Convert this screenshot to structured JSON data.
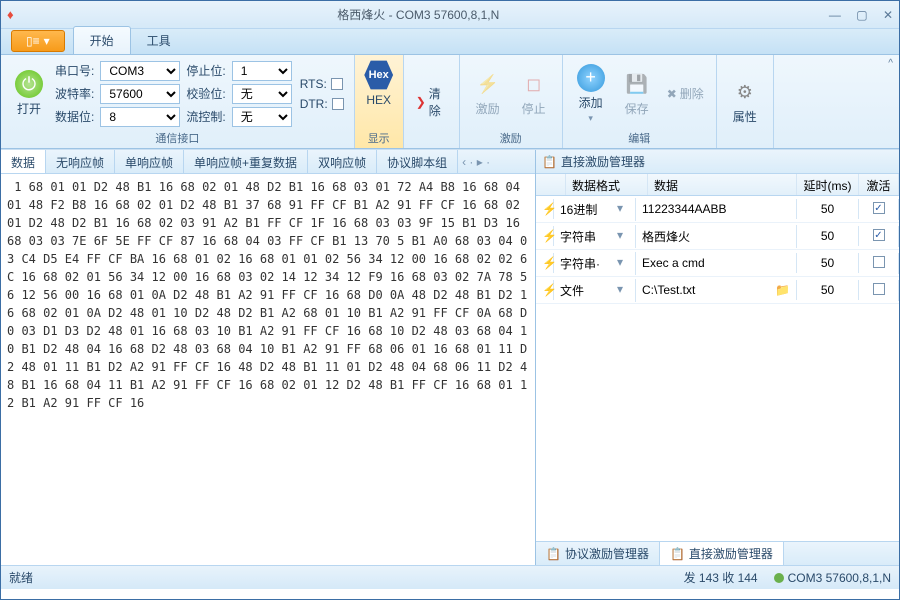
{
  "title": "格西烽火 - COM3  57600,8,1,N",
  "tabs": {
    "file": "▯≡",
    "t0": "开始",
    "t1": "工具"
  },
  "ribbon": {
    "open": "打开",
    "port_l": "串口号:",
    "port": "COM3",
    "baud_l": "波特率:",
    "baud": "57600",
    "dbit_l": "数据位:",
    "dbit": "8",
    "stop_l": "停止位:",
    "stop": "1",
    "par_l": "校验位:",
    "par": "无",
    "flow_l": "流控制:",
    "flow": "无",
    "rts": "RTS:",
    "dtr": "DTR:",
    "g_comm": "通信接口",
    "hex": "HEX",
    "g_show": "显示",
    "clear": "清除",
    "excite": "激励",
    "stop_btn": "停止",
    "g_excite": "激励",
    "add": "添加",
    "save": "保存",
    "del": "删除",
    "g_edit": "编辑",
    "props": "属性"
  },
  "datatabs": [
    "数据",
    "无响应帧",
    "单响应帧",
    "单响应帧+重复数据",
    "双响应帧",
    "协议脚本组"
  ],
  "hexdump": " 1 68 01 01 D2 48 B1 16 68 02 01 48 D2 B1 16 68 03 01 72 A4 B8 16 68 04 01 48 F2 B8 16 68 02 01 D2 48 B1 37 68 91 FF CF B1 A2 91 FF CF 16 68 02 01 D2 48 D2 B1 16 68 02 03 91 A2 B1 FF CF 1F 16 68 03 03 9F 15 B1 D3 16 68 03 03 7E 6F 5E FF CF 87 16 68 04 03 FF CF B1 13 70 5 B1 A0 68 03 04 03 C4 D5 E4 FF CF BA 16 68 01 02 16 68 01 01 02 56 34 12 00 16 68 02 02 6C 16 68 02 01 56 34 12 00 16 68 03 02 14 12 34 12 F9 16 68 03 02 7A 78 56 12 56 00 16 68 01 0A D2 48 B1 A2 91 FF CF 16 68 D0 0A 48 D2 48 B1 D2 16 68 02 01 0A D2 48 01 10 D2 48 D2 B1 A2 68 01 10 B1 A2 91 FF CF 0A 68 D0 03 D1 D3 D2 48 01 16 68 03 10 B1 A2 91 FF CF 16 68 10 D2 48 03 68 04 10 B1 D2 48 04 16 68 D2 48 03 68 04 10 B1 A2 91 FF 68 06 01 16 68 01 11 D2 48 01 11 B1 D2 A2 91 FF CF 16 48 D2 48 B1 11 01 D2 48 04 68 06 11 D2 48 B1 16 68 04 11 B1 A2 91 FF CF 16 68 02 01 12 D2 48 B1 FF CF 16 68 01 12 B1 A2 91 FF CF 16",
  "panel": {
    "title": "直接激励管理器",
    "c_fmt": "数据格式",
    "c_data": "数据",
    "c_delay": "延时(ms)",
    "c_act": "激活"
  },
  "rows": [
    {
      "fmt": "16进制",
      "data": "11223344AABB",
      "delay": "50",
      "on": true,
      "folder": false
    },
    {
      "fmt": "字符串",
      "data": "格西烽火",
      "delay": "50",
      "on": true,
      "folder": false
    },
    {
      "fmt": "字符串·",
      "data": "Exec a cmd",
      "delay": "50",
      "on": false,
      "folder": false
    },
    {
      "fmt": "文件",
      "data": "C:\\Test.txt",
      "delay": "50",
      "on": false,
      "folder": true
    }
  ],
  "btabs": {
    "t0": "协议激励管理器",
    "t1": "直接激励管理器"
  },
  "status": {
    "ready": "就绪",
    "tx": "发 143 收 144",
    "conn": "COM3  57600,8,1,N"
  }
}
